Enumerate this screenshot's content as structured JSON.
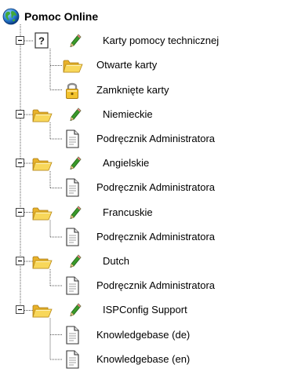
{
  "tree": {
    "root": {
      "label": "Pomoc Online",
      "icon": "globe-icon"
    },
    "nodes": [
      {
        "label": "Karty pomocy technicznej",
        "icon": "help-page-icon",
        "expanded": true,
        "editable": true,
        "children": [
          {
            "label": "Otwarte karty",
            "icon": "open-folder-icon"
          },
          {
            "label": "Zamknięte karty",
            "icon": "lock-icon"
          }
        ]
      },
      {
        "label": "Niemieckie",
        "icon": "open-folder-icon",
        "expanded": true,
        "editable": true,
        "children": [
          {
            "label": "Podręcznik Administratora",
            "icon": "document-icon"
          }
        ]
      },
      {
        "label": "Angielskie",
        "icon": "open-folder-icon",
        "expanded": true,
        "editable": true,
        "children": [
          {
            "label": "Podręcznik Administratora",
            "icon": "document-icon"
          }
        ]
      },
      {
        "label": "Francuskie",
        "icon": "open-folder-icon",
        "expanded": true,
        "editable": true,
        "children": [
          {
            "label": "Podręcznik Administratora",
            "icon": "document-icon"
          }
        ]
      },
      {
        "label": "Dutch",
        "icon": "open-folder-icon",
        "expanded": true,
        "editable": true,
        "children": [
          {
            "label": "Podręcznik Administratora",
            "icon": "document-icon"
          }
        ]
      },
      {
        "label": "ISPConfig Support",
        "icon": "open-folder-icon",
        "expanded": true,
        "editable": true,
        "children": [
          {
            "label": "Knowledgebase (de)",
            "icon": "document-icon"
          },
          {
            "label": "Knowledgebase (en)",
            "icon": "document-icon"
          }
        ]
      }
    ]
  },
  "colors": {
    "tree_line": "#555555",
    "folder": "#f5c842",
    "pencil": "#3a9a2a"
  }
}
